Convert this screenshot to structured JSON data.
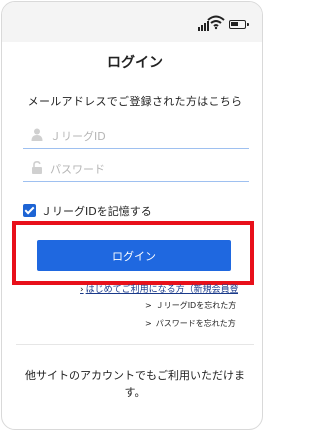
{
  "status_bar": {
    "signal_icon": "signal-icon",
    "wifi_icon": "wifi-icon",
    "battery_icon": "battery-icon"
  },
  "page": {
    "title": "ログイン",
    "lead": "メールアドレスでご登録された方はこちら"
  },
  "form": {
    "id_placeholder": "ＪリーグID",
    "password_placeholder": "パスワード",
    "remember_label": "ＪリーグIDを記憶する",
    "remember_checked": true,
    "login_button": "ログイン"
  },
  "links": {
    "first_time": "はじめてご利用になる方（新規会員登録）",
    "forgot_id": "ＪリーグIDを忘れた方",
    "forgot_password": "パスワードを忘れた方"
  },
  "other": {
    "text": "他サイトのアカウントでもご利用いただけます。"
  },
  "colors": {
    "accent": "#1f68e0",
    "highlight": "#e8101a"
  }
}
